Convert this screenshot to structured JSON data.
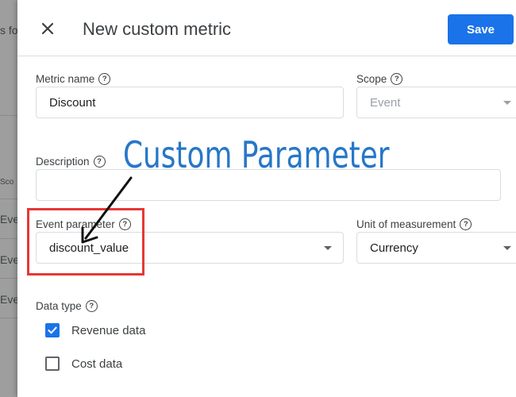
{
  "background": {
    "fragments": [
      "s fo",
      "Sco",
      "Eve",
      "Eve",
      "Eve"
    ]
  },
  "header": {
    "title": "New custom metric",
    "save_label": "Save"
  },
  "form": {
    "metric_name": {
      "label": "Metric name",
      "value": "Discount"
    },
    "scope": {
      "label": "Scope",
      "value": "Event"
    },
    "description": {
      "label": "Description",
      "value": ""
    },
    "event_parameter": {
      "label": "Event parameter",
      "value": "discount_value"
    },
    "unit_of_measurement": {
      "label": "Unit of measurement",
      "value": "Currency"
    },
    "data_type": {
      "label": "Data type",
      "options": [
        {
          "label": "Revenue data",
          "checked": true
        },
        {
          "label": "Cost data",
          "checked": false
        }
      ]
    }
  },
  "annotation": {
    "text": "Custom Parameter",
    "text_color": "#2777c8",
    "box_color": "#e53935"
  },
  "colors": {
    "accent": "#1a73e8",
    "border": "#dadce0"
  }
}
